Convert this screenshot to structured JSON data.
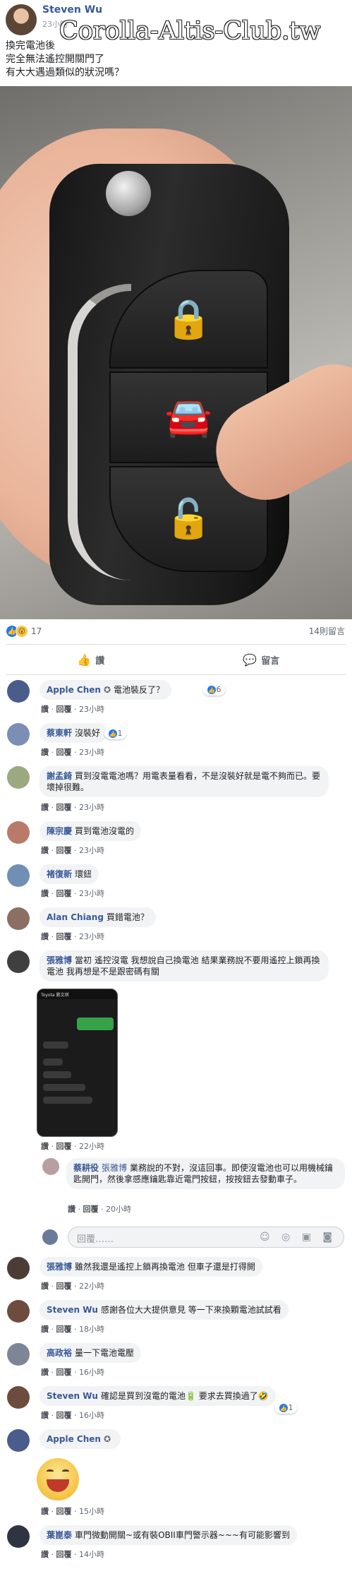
{
  "post": {
    "author": "Steven Wu",
    "time": "23小時",
    "watermark": "Corolla-Altis-Club.tw",
    "text_lines": [
      "換完電池後",
      "完全無法遙控開關門了",
      "有大大遇過類似的狀況嗎？"
    ]
  },
  "photo_icons": [
    "lock-icon",
    "trunk-icon",
    "unlock-icon"
  ],
  "reactions": {
    "count": "17",
    "share_text": "14則留言"
  },
  "actions": {
    "like": "讚",
    "comment": "留言"
  },
  "meta_labels": {
    "like": "讚",
    "reply": "回覆"
  },
  "comments": [
    {
      "name": "Apple Chen",
      "badge": "✪",
      "text": "電池裝反了？",
      "time": "23小時",
      "reaction_count": "6"
    },
    {
      "name": "蔡東軒",
      "text": "沒裝好",
      "time": "23小時",
      "reaction_count": "1"
    },
    {
      "name": "謝孟錡",
      "text": "買到沒電電池嗎？用電表量看看，不是沒裝好就是電不夠而已。要壞掉很難。",
      "time": "23小時"
    },
    {
      "name": "陳宗慶",
      "text": "買到電池沒電的",
      "time": "23小時"
    },
    {
      "name": "褚復新",
      "text": "環鈕",
      "time": "23小時"
    },
    {
      "name": "Alan Chiang",
      "text": "買錯電池？",
      "time": "23小時"
    },
    {
      "name": "張雅博",
      "text": "當初 遙控沒電 我想說自己換電池 結果業務說不要用遙控上鎖再換電池 我再想是不是跟密碼有關",
      "time": "22小時"
    },
    {
      "name": "蔡耕役",
      "mention": "張雅博",
      "text": "業務說的不對，沒這回事。即使沒電池也可以用機械鑰匙開門，然後拿感應鑰匙靠近電門按鈕，按按鈕去發動車子。",
      "time": "20小時"
    },
    {
      "name": "張雅博",
      "text": "雖然我還是遙控上鎖再換電池 但車子還是打得開",
      "time": "22小時"
    },
    {
      "name": "Steven Wu",
      "text": "感謝各位大大提供意見 等一下來換顆電池試試看",
      "time": "18小時"
    },
    {
      "name": "高政裕",
      "text": "量一下電池電壓",
      "time": "16小時"
    },
    {
      "name": "Steven Wu",
      "text": "確認是買到沒電的電池🔋 要求去買換過了🤣",
      "time": "16小時",
      "reaction_count": "1"
    },
    {
      "name": "Apple Chen",
      "badge": "✪",
      "text": "",
      "time": "15小時"
    },
    {
      "name": "葉崑泰",
      "text": "車門微動開關~或有裝OBII車門警示器~~~有可能影響到",
      "time": "14小時"
    }
  ],
  "screenshot": {
    "contact": "Toyota 劉文琪"
  },
  "reply_placeholder": "回覆……",
  "reply_icons": "☺ ◎ ▣ ◙",
  "colors": {
    "link": "#385898",
    "bubble": "#f2f3f5",
    "like": "#2078f4"
  }
}
